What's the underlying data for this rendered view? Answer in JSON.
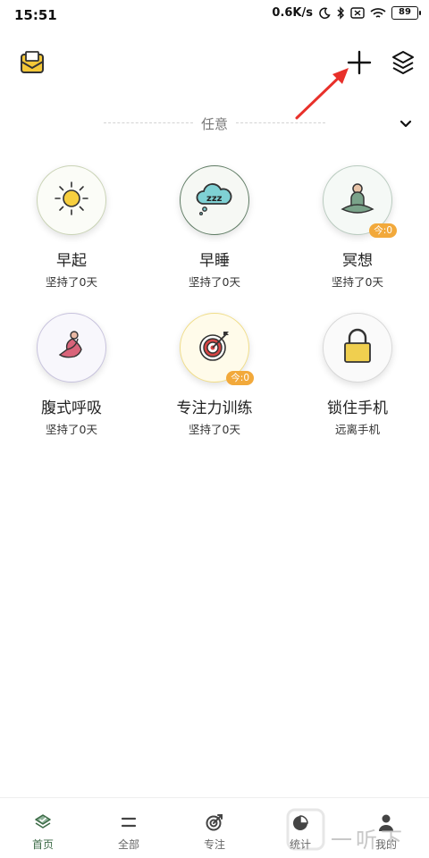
{
  "status_bar": {
    "time": "15:51",
    "network_speed": "0.6K/s",
    "battery": "89",
    "icons": [
      "moon-icon",
      "bluetooth-icon",
      "sim-icon",
      "wifi-icon",
      "battery-icon"
    ]
  },
  "header": {
    "left_icon": "mail-icon",
    "right_icons": [
      "plus-icon",
      "layers-icon"
    ]
  },
  "category": {
    "label": "任意",
    "dropdown_icon": "chevron-down-icon"
  },
  "habits": [
    {
      "name": "早起",
      "subtitle": "坚持了0天",
      "icon": "sun-icon",
      "ring_color": "#c9d3b5",
      "bg": "#fbfcf7",
      "badge": ""
    },
    {
      "name": "早睡",
      "subtitle": "坚持了0天",
      "icon": "sleep-cloud-icon",
      "ring_color": "#5e7b63",
      "bg": "#f6f8f4",
      "badge": ""
    },
    {
      "name": "冥想",
      "subtitle": "坚持了0天",
      "icon": "meditation-icon",
      "ring_color": "#b9cbbf",
      "bg": "#f5f9f6",
      "badge": "今:0"
    },
    {
      "name": "腹式呼吸",
      "subtitle": "坚持了0天",
      "icon": "yoga-icon",
      "ring_color": "#c7c2dd",
      "bg": "#f8f7fc",
      "badge": ""
    },
    {
      "name": "专注力训练",
      "subtitle": "坚持了0天",
      "icon": "target-icon",
      "ring_color": "#f0dd88",
      "bg": "#fffbea",
      "badge": "今:0"
    },
    {
      "name": "锁住手机",
      "subtitle": "远离手机",
      "icon": "lock-icon",
      "ring_color": "#d8d8d8",
      "bg": "#fafafa",
      "badge": ""
    }
  ],
  "bottom_nav": [
    {
      "label": "首页",
      "icon": "home-check-icon",
      "active": true
    },
    {
      "label": "全部",
      "icon": "list-icon",
      "active": false
    },
    {
      "label": "专注",
      "icon": "focus-icon",
      "active": false
    },
    {
      "label": "统计",
      "icon": "pie-chart-icon",
      "active": false
    },
    {
      "label": "我的",
      "icon": "user-icon",
      "active": false
    }
  ],
  "watermark": "一听下载",
  "colors": {
    "accent_green": "#3d6b47",
    "badge_orange": "#f2a93b",
    "annotation_red": "#e8302a"
  }
}
